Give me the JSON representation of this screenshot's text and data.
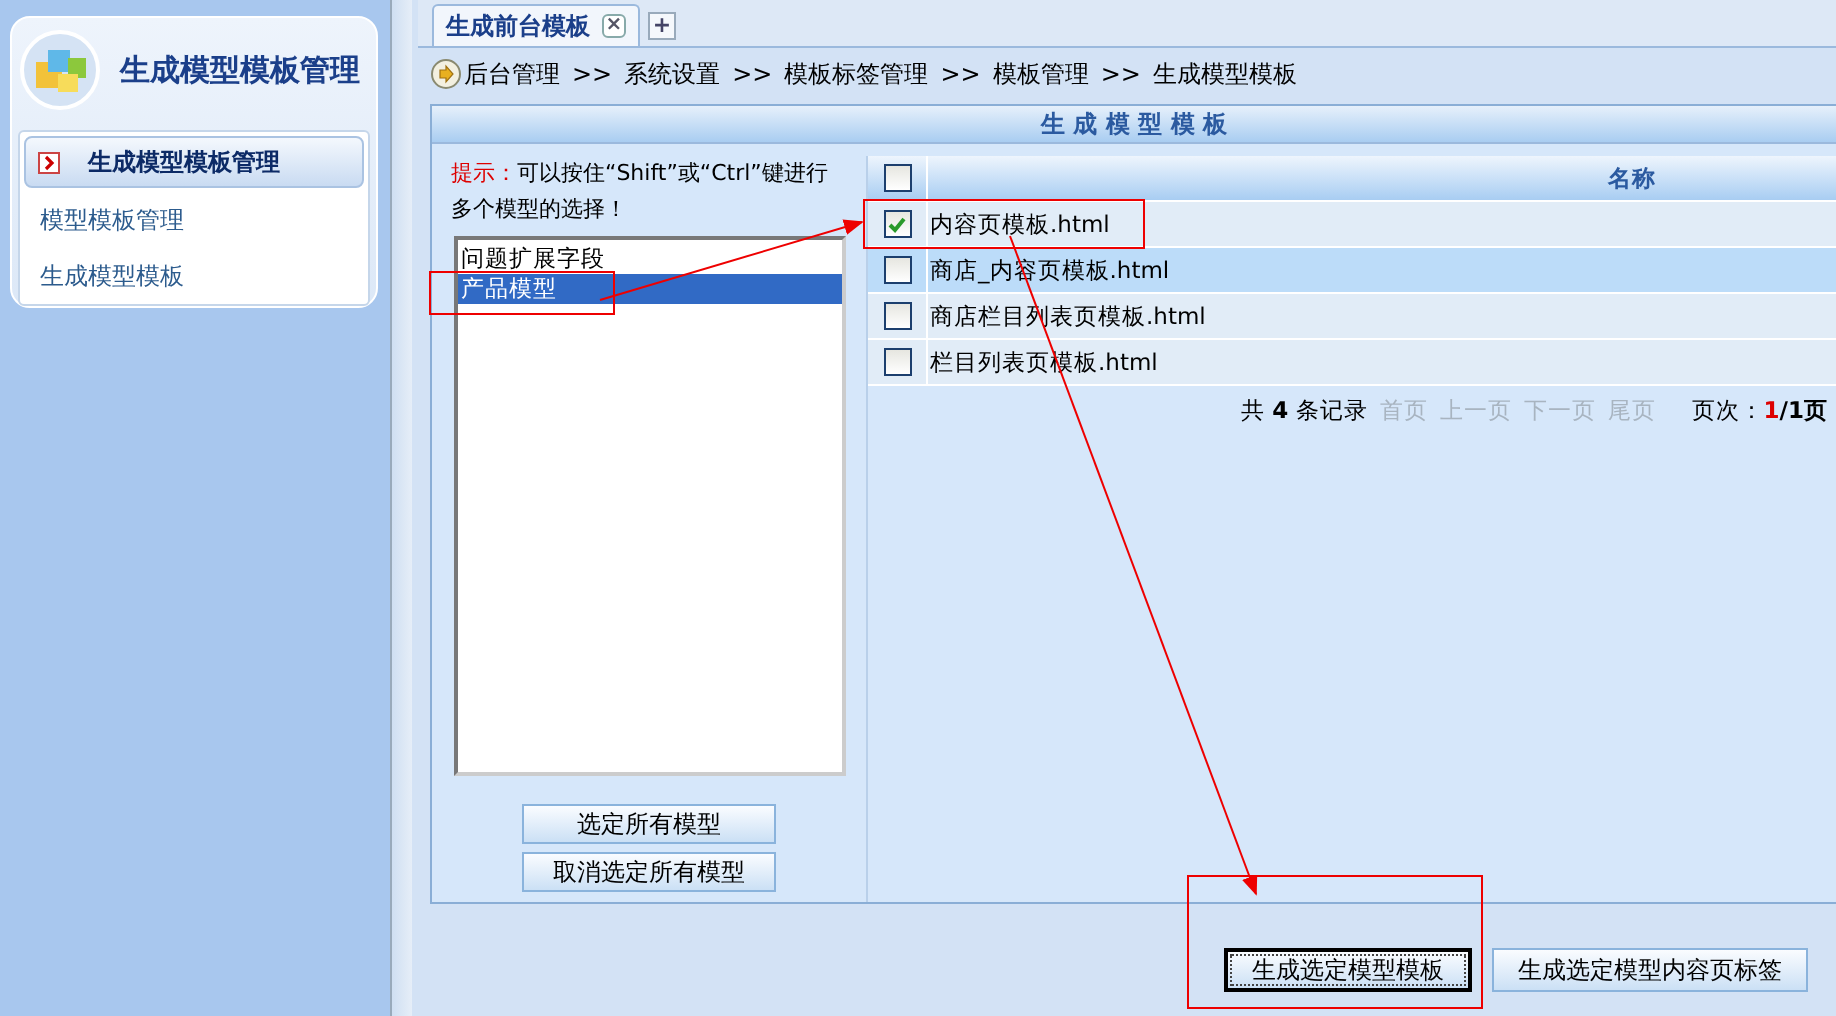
{
  "sidebar": {
    "title": "生成模型模板管理",
    "items": [
      {
        "label": "生成模型模板管理",
        "selected": true
      },
      {
        "label": "模型模板管理",
        "selected": false
      },
      {
        "label": "生成模型模板",
        "selected": false
      }
    ]
  },
  "tabs": [
    {
      "label": "生成前台模板",
      "selected": true,
      "close": "×"
    }
  ],
  "new_tab": "+",
  "breadcrumb": [
    "后台管理",
    "系统设置",
    "模板标签管理",
    "模板管理",
    "生成模型模板"
  ],
  "breadcrumb_separator": ">>",
  "panel_title": "生 成 模 型 模 板",
  "hint": {
    "label": "提示：",
    "text": "可以按住“Shift”或“Ctrl”键进行多个模型的选择！"
  },
  "models": [
    {
      "label": "问题扩展字段",
      "selected": false
    },
    {
      "label": "产品模型",
      "selected": true
    }
  ],
  "model_buttons": [
    "选定所有模型",
    "取消选定所有模型"
  ],
  "table": {
    "columns": [
      "名称"
    ],
    "header_checked": false,
    "rows": [
      {
        "name": "内容页模板.html",
        "checked": true,
        "highlighted": false
      },
      {
        "name": "商店_内容页模板.html",
        "checked": false,
        "highlighted": true
      },
      {
        "name": "商店栏目列表页模板.html",
        "checked": false,
        "highlighted": false
      },
      {
        "name": "栏目列表页模板.html",
        "checked": false,
        "highlighted": false
      }
    ]
  },
  "pagination": {
    "summary": "共 **4** 条记录",
    "links": [
      {
        "label": "首页",
        "disabled": true
      },
      {
        "label": "上一页",
        "disabled": true
      },
      {
        "label": "下一页",
        "disabled": true
      },
      {
        "label": "尾页",
        "disabled": true
      }
    ],
    "page_label": "页次：",
    "current": "1",
    "total": "/1页"
  },
  "actions": [
    {
      "label": "生成选定模型模板",
      "default": true
    },
    {
      "label": "生成选定模型内容页标签",
      "default": false
    }
  ]
}
